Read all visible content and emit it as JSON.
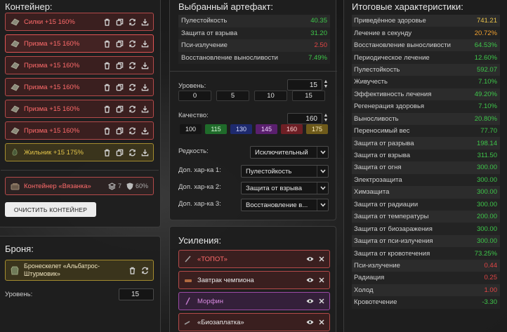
{
  "container": {
    "title": "Контейнер:",
    "items": [
      {
        "name": "Силки +15 160%",
        "color": "red",
        "selected": false
      },
      {
        "name": "Призма +15 160%",
        "color": "red",
        "selected": true
      },
      {
        "name": "Призма +15 160%",
        "color": "red",
        "selected": false
      },
      {
        "name": "Призма +15 160%",
        "color": "red",
        "selected": false
      },
      {
        "name": "Призма +15 160%",
        "color": "red",
        "selected": false
      },
      {
        "name": "Призма +15 160%",
        "color": "red",
        "selected": false
      },
      {
        "name": "Жильник +15 175%",
        "color": "gold",
        "selected": false
      }
    ],
    "box": {
      "name": "Контейнер «Вязанка»",
      "slots": "7",
      "protection": "60%"
    },
    "clear_button": "ОЧИСТИТЬ КОНТЕЙНЕР"
  },
  "armor": {
    "title": "Броня:",
    "item_name": "Бронескелет «Альбатрос-Штурмовик»",
    "level_label": "Уровень:",
    "level_value": "15"
  },
  "artifact": {
    "title": "Выбранный артефакт:",
    "stats": [
      {
        "label": "Пулестойкость",
        "value": "40.35",
        "tone": "green"
      },
      {
        "label": "Защита от взрыва",
        "value": "31.20",
        "tone": "green"
      },
      {
        "label": "Пси-излучение",
        "value": "2.50",
        "tone": "red"
      },
      {
        "label": "Восстановление выносливости",
        "value": "7.49%",
        "tone": "green"
      }
    ],
    "level_label": "Уровень:",
    "level_value": "15",
    "level_presets": [
      "0",
      "5",
      "10",
      "15"
    ],
    "quality_label": "Качество:",
    "quality_value": "160",
    "quality_presets": [
      {
        "label": "100",
        "bg": "#151515",
        "fg": "#e0e0e0"
      },
      {
        "label": "115",
        "bg": "#1f6b2a",
        "fg": "#d8f5d8"
      },
      {
        "label": "130",
        "bg": "#1e2a6e",
        "fg": "#d6dcff"
      },
      {
        "label": "145",
        "bg": "#5a1f6e",
        "fg": "#f1d8ff"
      },
      {
        "label": "160",
        "bg": "#6e1f25",
        "fg": "#ffd6d6"
      },
      {
        "label": "175",
        "bg": "#6e5a1a",
        "fg": "#fff0c0"
      }
    ],
    "rarity_label": "Редкость:",
    "rarity_value": "Исключительный",
    "extra": [
      {
        "label": "Доп. хар-ка 1:",
        "value": "Пулестойкость"
      },
      {
        "label": "Доп. хар-ка 2:",
        "value": "Защита от взрыва"
      },
      {
        "label": "Доп. хар-ка 3:",
        "value": "Восстановление в..."
      }
    ]
  },
  "upgrades": {
    "title": "Усиления:",
    "items": [
      {
        "name": "«ТОПОТ»",
        "color": "red",
        "text": "red"
      },
      {
        "name": "Завтрак чемпиона",
        "color": "red",
        "text": "white"
      },
      {
        "name": "Морфин",
        "color": "purple",
        "text": "purple"
      },
      {
        "name": "«Биозаплатка»",
        "color": "red",
        "text": "white"
      }
    ]
  },
  "totals": {
    "title": "Итоговые характеристики:",
    "rows": [
      {
        "label": "Приведённое здоровье",
        "value": "741.21",
        "tone": "gold"
      },
      {
        "label": "Лечение в секунду",
        "value": "20.72%",
        "tone": "orange"
      },
      {
        "label": "Восстановление выносливости",
        "value": "64.53%",
        "tone": "green"
      },
      {
        "label": "Периодическое лечение",
        "value": "12.60%",
        "tone": "green"
      },
      {
        "label": "Пулестойкость",
        "value": "592.07",
        "tone": "green"
      },
      {
        "label": "Живучесть",
        "value": "7.10%",
        "tone": "green"
      },
      {
        "label": "Эффективность лечения",
        "value": "49.20%",
        "tone": "green"
      },
      {
        "label": "Регенерация здоровья",
        "value": "7.10%",
        "tone": "green"
      },
      {
        "label": "Выносливость",
        "value": "20.80%",
        "tone": "green"
      },
      {
        "label": "Переносимый вес",
        "value": "77.70",
        "tone": "green"
      },
      {
        "label": "Защита от разрыва",
        "value": "198.14",
        "tone": "green"
      },
      {
        "label": "Защита от взрыва",
        "value": "311.50",
        "tone": "green"
      },
      {
        "label": "Защита от огня",
        "value": "300.00",
        "tone": "green"
      },
      {
        "label": "Электрозащита",
        "value": "300.00",
        "tone": "green"
      },
      {
        "label": "Химзащита",
        "value": "300.00",
        "tone": "green"
      },
      {
        "label": "Защита от радиации",
        "value": "300.00",
        "tone": "green"
      },
      {
        "label": "Защита от температуры",
        "value": "200.00",
        "tone": "green"
      },
      {
        "label": "Защита от биозаражения",
        "value": "300.00",
        "tone": "green"
      },
      {
        "label": "Защита от пси-излучения",
        "value": "300.00",
        "tone": "green"
      },
      {
        "label": "Защита от кровотечения",
        "value": "73.25%",
        "tone": "green"
      },
      {
        "label": "Пси-излучение",
        "value": "0.44",
        "tone": "red"
      },
      {
        "label": "Радиация",
        "value": "0.25",
        "tone": "red"
      },
      {
        "label": "Холод",
        "value": "1.00",
        "tone": "red"
      },
      {
        "label": "Кровотечение",
        "value": "-3.30",
        "tone": "green"
      }
    ]
  }
}
